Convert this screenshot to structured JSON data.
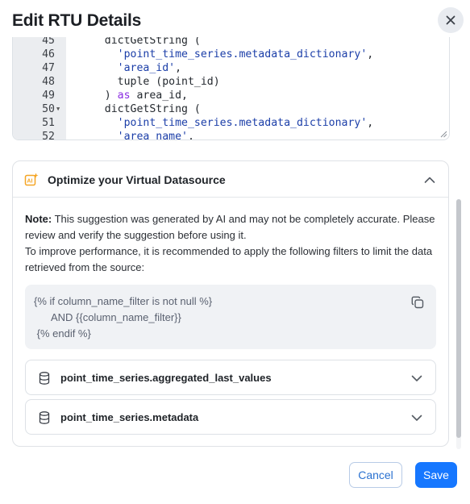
{
  "dialog": {
    "title": "Edit RTU Details"
  },
  "editor": {
    "lines": [
      {
        "num": "45",
        "fold": false,
        "parts": [
          {
            "t": "    dictGetString (",
            "c": "plain"
          }
        ]
      },
      {
        "num": "46",
        "fold": false,
        "parts": [
          {
            "t": "      ",
            "c": "plain"
          },
          {
            "t": "'point_time_series.metadata_dictionary'",
            "c": "str"
          },
          {
            "t": ",",
            "c": "plain"
          }
        ]
      },
      {
        "num": "47",
        "fold": false,
        "parts": [
          {
            "t": "      ",
            "c": "plain"
          },
          {
            "t": "'area_id'",
            "c": "str"
          },
          {
            "t": ",",
            "c": "plain"
          }
        ]
      },
      {
        "num": "48",
        "fold": false,
        "parts": [
          {
            "t": "      tuple (point_id)",
            "c": "plain"
          }
        ]
      },
      {
        "num": "49",
        "fold": false,
        "parts": [
          {
            "t": "    ) ",
            "c": "plain"
          },
          {
            "t": "as",
            "c": "kw"
          },
          {
            "t": " area_id,",
            "c": "plain"
          }
        ]
      },
      {
        "num": "50",
        "fold": true,
        "parts": [
          {
            "t": "    dictGetString (",
            "c": "plain"
          }
        ]
      },
      {
        "num": "51",
        "fold": false,
        "parts": [
          {
            "t": "      ",
            "c": "plain"
          },
          {
            "t": "'point_time_series.metadata_dictionary'",
            "c": "str"
          },
          {
            "t": ",",
            "c": "plain"
          }
        ]
      },
      {
        "num": "52",
        "fold": false,
        "parts": [
          {
            "t": "      ",
            "c": "plain"
          },
          {
            "t": "'area_name'",
            "c": "str"
          },
          {
            "t": ",",
            "c": "plain"
          }
        ]
      }
    ]
  },
  "optimize": {
    "title": "Optimize your Virtual Datasource",
    "note_label": "Note:",
    "note_text": " This suggestion was generated by AI and may not be completely accurate. Please review and verify the suggestion before using it.",
    "recommendation": "To improve performance, it is recommended to apply the following filters to limit the data retrieved from the source:",
    "filter_lines": [
      "{% if column_name_filter is not null %}",
      "      AND {{column_name_filter}}",
      " {% endif %}"
    ],
    "datasources": [
      {
        "label": "point_time_series.aggregated_last_values"
      },
      {
        "label": "point_time_series.metadata"
      }
    ]
  },
  "footer": {
    "cancel_label": "Cancel",
    "save_label": "Save"
  },
  "icons": {
    "close": "close-icon",
    "ai": "ai-sparkle-icon",
    "collapse": "chevron-up-icon",
    "copy": "copy-icon",
    "database": "database-icon",
    "expand": "chevron-down-icon"
  },
  "colors": {
    "primary": "#1677ff",
    "cancel_text": "#2a71d0",
    "code_string": "#1b3ea8",
    "code_keyword": "#8a2be2",
    "ai_icon": "#f5a524"
  }
}
